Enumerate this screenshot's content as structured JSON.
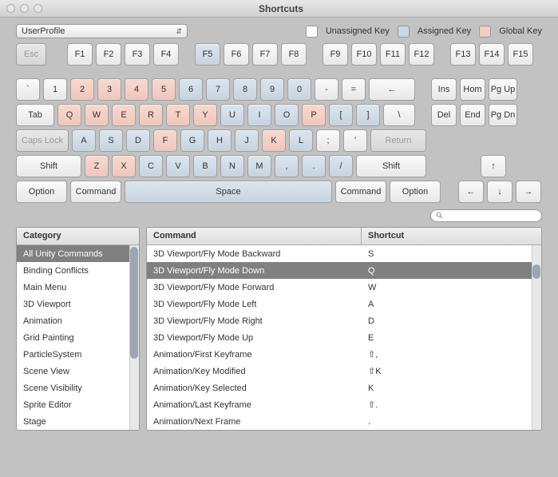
{
  "window": {
    "title": "Shortcuts"
  },
  "profile": {
    "label": "UserProfile"
  },
  "legend": {
    "unassigned": "Unassigned Key",
    "assigned": "Assigned Key",
    "global": "Global Key"
  },
  "keys": {
    "esc": "Esc",
    "fkeys": [
      "F1",
      "F2",
      "F3",
      "F4",
      "F5",
      "F6",
      "F7",
      "F8",
      "F9",
      "F10",
      "F11",
      "F12",
      "F13",
      "F14",
      "F15"
    ],
    "fkeys_state": [
      "un",
      "un",
      "un",
      "un",
      "as",
      "un",
      "un",
      "un",
      "un",
      "un",
      "un",
      "un",
      "un",
      "un",
      "un"
    ],
    "row1": [
      "`",
      "1",
      "2",
      "3",
      "4",
      "5",
      "6",
      "7",
      "8",
      "9",
      "0",
      "-",
      "="
    ],
    "row1_state": [
      "un",
      "un",
      "gl",
      "gl",
      "gl",
      "gl",
      "as",
      "as",
      "as",
      "as",
      "as",
      "un",
      "un"
    ],
    "back": "←",
    "ins": "Ins",
    "hom": "Hom",
    "pgup": "Pg Up",
    "tab": "Tab",
    "row2": [
      "Q",
      "W",
      "E",
      "R",
      "T",
      "Y",
      "U",
      "I",
      "O",
      "P",
      "[",
      "]"
    ],
    "row2_state": [
      "gl",
      "gl",
      "gl",
      "gl",
      "gl",
      "gl",
      "as",
      "as",
      "as",
      "gl",
      "as",
      "as"
    ],
    "bslash": "\\",
    "del": "Del",
    "end": "End",
    "pgdn": "Pg Dn",
    "caps": "Caps Lock",
    "row3": [
      "A",
      "S",
      "D",
      "F",
      "G",
      "H",
      "J",
      "K",
      "L",
      ";",
      "'"
    ],
    "row3_state": [
      "as",
      "as",
      "as",
      "gl",
      "as",
      "as",
      "as",
      "gl",
      "as",
      "un",
      "un"
    ],
    "return": "Return",
    "shift": "Shift",
    "row4": [
      "Z",
      "X",
      "C",
      "V",
      "B",
      "N",
      "M",
      ",",
      ".",
      "/"
    ],
    "row4_state": [
      "gl",
      "gl",
      "as",
      "as",
      "as",
      "as",
      "as",
      "as",
      "as",
      "as"
    ],
    "up": "↑",
    "opt": "Option",
    "cmd": "Command",
    "space": "Space",
    "left": "←",
    "down": "↓",
    "right": "→"
  },
  "headers": {
    "category": "Category",
    "command": "Command",
    "shortcut": "Shortcut"
  },
  "categories": [
    "All Unity Commands",
    "Binding Conflicts",
    "Main Menu",
    "3D Viewport",
    "Animation",
    "Grid Painting",
    "ParticleSystem",
    "Scene View",
    "Scene Visibility",
    "Sprite Editor",
    "Stage"
  ],
  "cat_selected": 0,
  "commands": [
    {
      "c": "3D Viewport/Fly Mode Backward",
      "s": "S"
    },
    {
      "c": "3D Viewport/Fly Mode Down",
      "s": "Q"
    },
    {
      "c": "3D Viewport/Fly Mode Forward",
      "s": "W"
    },
    {
      "c": "3D Viewport/Fly Mode Left",
      "s": "A"
    },
    {
      "c": "3D Viewport/Fly Mode Right",
      "s": "D"
    },
    {
      "c": "3D Viewport/Fly Mode Up",
      "s": "E"
    },
    {
      "c": "Animation/First Keyframe",
      "s": "⇧,"
    },
    {
      "c": "Animation/Key Modified",
      "s": "⇧K"
    },
    {
      "c": "Animation/Key Selected",
      "s": "K"
    },
    {
      "c": "Animation/Last Keyframe",
      "s": "⇧."
    },
    {
      "c": "Animation/Next Frame",
      "s": "."
    }
  ],
  "cmd_selected": 1
}
